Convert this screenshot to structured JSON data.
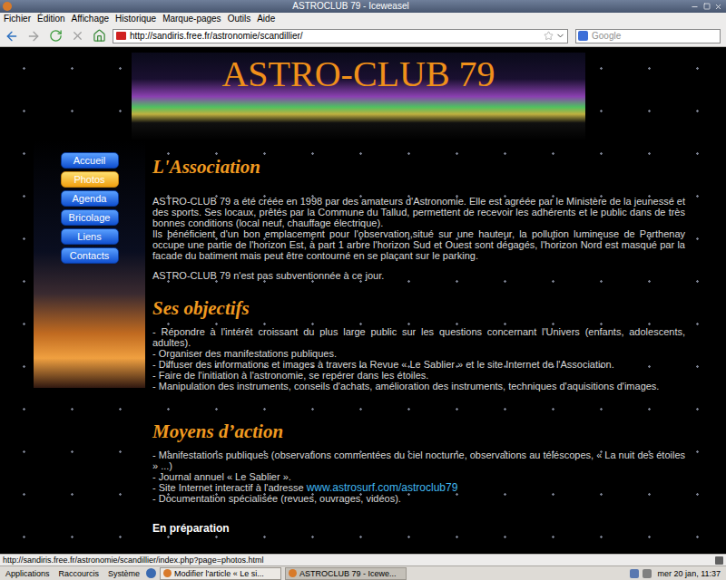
{
  "window": {
    "title": "ASTROCLUB 79 - Iceweasel"
  },
  "menu": [
    {
      "label": "Fichier"
    },
    {
      "label": "Édition"
    },
    {
      "label": "Affichage"
    },
    {
      "label": "Historique"
    },
    {
      "label": "Marque-pages"
    },
    {
      "label": "Outils"
    },
    {
      "label": "Aide"
    }
  ],
  "toolbar": {
    "back_enabled": true,
    "forward_enabled": false,
    "stop_enabled": false,
    "url": "http://sandiris.free.fr/astronomie/scandillier/",
    "search_placeholder": "Google"
  },
  "page": {
    "banner_title": "ASTRO-CLUB 79",
    "nav": [
      {
        "label": "Accueil",
        "selected": false
      },
      {
        "label": "Photos",
        "selected": true
      },
      {
        "label": "Agenda",
        "selected": false
      },
      {
        "label": "Bricolage",
        "selected": false
      },
      {
        "label": "Liens",
        "selected": false
      },
      {
        "label": "Contacts",
        "selected": false
      }
    ],
    "sections": [
      {
        "heading": "L'Association",
        "paragraphs": [
          [
            {
              "text": "ASTRO-CLUB 79 a été créée en 1998 par des amateurs d'Astronomie. Elle est agréée par le Ministère de la jeunessé et des sports. Ses locaux, prêtés par la Commune du Tallud, permettent de recevoir les adhérents et le public dans de très bonnes conditions (local neuf, chauffage électrique)."
            },
            {
              "text": "Ils bénéficient d'un bon emplacement pour l'observation,situé sur une hauteur, la pollution lumineuse de Parthenay occupe une partie de l'horizon Est, à part 1 arbre l'horizon Sud et Ouest sont dégagés, l'horizon Nord  est masqué par la facade du batiment mais peut être contourné en se plaçant sur le parking."
            }
          ],
          [
            {
              "text": "ASTRO-CLUB 79 n'est pas subventionnée à ce jour."
            }
          ]
        ]
      },
      {
        "heading": "Ses objectifs",
        "paragraphs": [
          [
            {
              "text": "- Répondre à l'intérêt croissant du plus large public sur les questions concernant l'Univers (enfants, adolescents, adultes)."
            },
            {
              "text": "- Organiser des manifestations publiques."
            },
            {
              "text": "- Diffuser des informations et images à travers la Revue « Le Sablier » et le site Internet de l'Association."
            },
            {
              "text": "- Faire de l'initiation à l'astronomie, se repérer dans les étoiles."
            },
            {
              "text": "- Manipulation des instruments, conseils d'achats, amélioration des instruments, techniques d'aquisitions d'images."
            }
          ]
        ]
      },
      {
        "heading": "Moyens d’action",
        "paragraphs": [
          [
            {
              "text": "- Manifestations publiques (observations commentées du ciel nocturne, observations au téléscopes, « La nuit des étoiles » ...)"
            },
            {
              "text": "- Journal annuel « Le Sablier »."
            },
            {
              "text": "- Site Internet interactif à l'adresse ",
              "link": "www.astrosurf.com/astroclub79"
            },
            {
              "text": "- Documentation spécialisée (revues, ouvrages, vidéos)."
            }
          ]
        ]
      }
    ],
    "subheading": "En préparation"
  },
  "status_bar": "http://sandiris.free.fr/astronomie/scandillier/index.php?page=photos.html",
  "taskbar": {
    "menus": [
      "Applications",
      "Raccourcis",
      "Système"
    ],
    "tasks": [
      {
        "label": "Modifier l'article « Le si...",
        "selected": false
      },
      {
        "label": "ASTROCLUB 79 - Icewe...",
        "selected": true
      }
    ],
    "clock": "mer 20 jan, 11:37"
  }
}
